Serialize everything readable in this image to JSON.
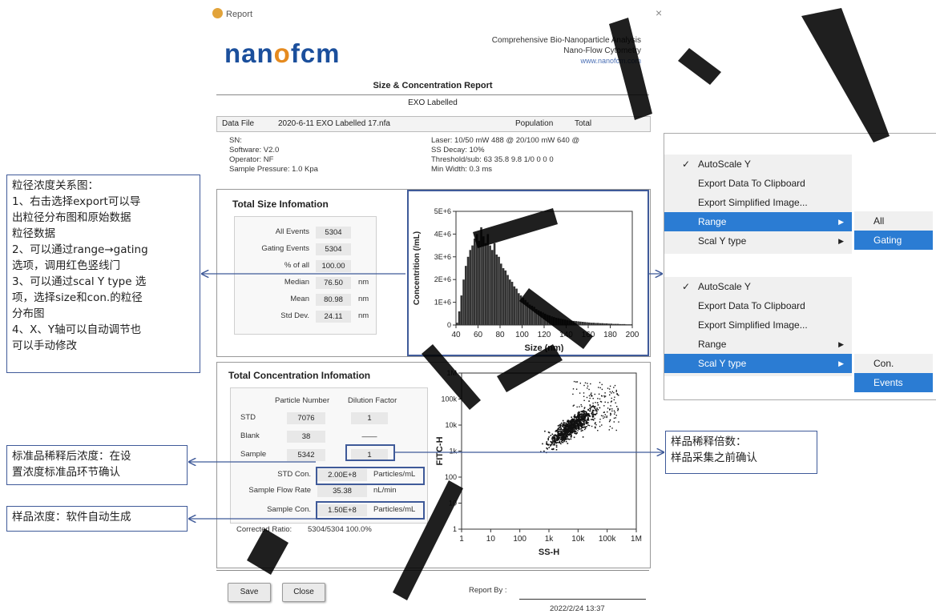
{
  "window": {
    "title": "Report",
    "close": "×"
  },
  "header": {
    "logo_a": "nan",
    "logo_o": "o",
    "logo_b": "fcm",
    "company_line1": "Comprehensive Bio-Nanoparticle Analysis",
    "company_line2": "Nano-Flow Cytometry",
    "company_url": "www.nanofcm.com"
  },
  "report": {
    "title": "Size & Concentration Report",
    "subtitle": "EXO Labelled",
    "data_file_label": "Data File",
    "data_file": "2020-6-11 EXO Labelled 17.nfa",
    "population_label": "Population",
    "population": "Total",
    "meta_left": [
      "SN:",
      "Software: V2.0",
      "Operator: NF",
      "Sample Pressure: 1.0 Kpa"
    ],
    "meta_right": [
      "Laser: 10/50 mW 488 @ 20/100 mW 640 @",
      "SS Decay: 10%",
      "Threshold/sub: 63 35.8 9.8 1/0 0 0 0",
      "Min Width: 0.3 ms"
    ]
  },
  "size_info": {
    "title": "Total Size Infomation",
    "rows": [
      {
        "label": "All Events",
        "value": "5304",
        "unit": ""
      },
      {
        "label": "Gating Events",
        "value": "5304",
        "unit": ""
      },
      {
        "label": "% of all",
        "value": "100.00",
        "unit": ""
      },
      {
        "label": "Median",
        "value": "76.50",
        "unit": "nm"
      },
      {
        "label": "Mean",
        "value": "80.98",
        "unit": "nm"
      },
      {
        "label": "Std Dev.",
        "value": "24.11",
        "unit": "nm"
      }
    ]
  },
  "conc_info": {
    "title": "Total Concentration Infomation",
    "col_particle": "Particle Number",
    "col_dilution": "Dilution Factor",
    "rows": [
      {
        "label": "STD",
        "particle": "7076",
        "dilution": "1"
      },
      {
        "label": "Blank",
        "particle": "38",
        "dilution": "——"
      },
      {
        "label": "Sample",
        "particle": "5342",
        "dilution": "1"
      }
    ],
    "std_con_label": "STD Con.",
    "std_con": "2.00E+8",
    "std_con_unit": "Particles/mL",
    "flow_label": "Sample Flow Rate",
    "flow": "35.38",
    "flow_unit": "nL/min",
    "sample_con_label": "Sample Con.",
    "sample_con": "1.50E+8",
    "sample_con_unit": "Particles/mL",
    "corrected_label": "Corrected Ratio:",
    "corrected": "5304/5304  100.0%"
  },
  "chart_data": [
    {
      "type": "bar",
      "xlabel": "Size (nm)",
      "ylabel": "Concentrition (/mL)",
      "xlim": [
        40,
        200
      ],
      "ylim": [
        0,
        5000000
      ],
      "xticks": [
        "40",
        "60",
        "80",
        "100",
        "120",
        "140",
        "160",
        "180",
        "200"
      ],
      "yticks": [
        "0",
        "1E+6",
        "2E+6",
        "3E+6",
        "4E+6",
        "5E+6"
      ],
      "x": [
        41,
        43,
        45,
        47,
        49,
        51,
        53,
        55,
        57,
        59,
        61,
        63,
        65,
        67,
        69,
        71,
        73,
        75,
        77,
        79,
        81,
        83,
        85,
        87,
        89,
        91,
        93,
        95,
        97,
        99,
        101,
        103,
        105,
        107,
        109,
        111,
        113,
        115,
        117,
        119,
        121,
        123,
        125,
        127,
        129,
        131,
        133,
        135,
        137,
        139,
        141,
        143,
        145,
        147,
        149,
        151,
        153,
        155,
        157,
        159,
        161,
        163,
        165,
        167,
        169,
        171,
        173,
        175,
        177,
        179,
        181,
        183,
        185,
        187,
        189,
        191,
        193,
        195,
        197,
        199
      ],
      "values": [
        100000,
        600000,
        1300000,
        2000000,
        2600000,
        3000000,
        3300000,
        3500000,
        3800000,
        4000000,
        3700000,
        4300000,
        3900000,
        3600000,
        4000000,
        3500000,
        3300000,
        3600000,
        3100000,
        3000000,
        2700000,
        2500000,
        2400000,
        2200000,
        2000000,
        1900000,
        1700000,
        1600000,
        1400000,
        1300000,
        1200000,
        1100000,
        1000000,
        900000,
        850000,
        800000,
        700000,
        650000,
        600000,
        550000,
        500000,
        450000,
        420000,
        380000,
        350000,
        320000,
        300000,
        280000,
        260000,
        240000,
        220000,
        200000,
        190000,
        180000,
        170000,
        160000,
        150000,
        140000,
        130000,
        120000,
        110000,
        100000,
        100000,
        90000,
        90000,
        80000,
        80000,
        70000,
        70000,
        60000,
        60000,
        50000,
        50000,
        50000,
        40000,
        40000,
        40000,
        30000,
        30000,
        30000
      ]
    },
    {
      "type": "scatter",
      "xlabel": "SS-H",
      "ylabel": "FITC-H",
      "xticks": [
        "1",
        "10",
        "100",
        "1k",
        "10k",
        "100k",
        "1M"
      ],
      "yticks": [
        "1",
        "10",
        "100",
        "1k",
        "10k",
        "100k",
        "1M"
      ],
      "xscale": "log",
      "yscale": "log"
    }
  ],
  "context_menu": {
    "top": {
      "items": [
        {
          "label": "AutoScale Y",
          "checked": "✓"
        },
        {
          "label": "Export Data To Clipboard"
        },
        {
          "label": "Export Simplified Image..."
        },
        {
          "label": "Range"
        },
        {
          "label": "Scal Y type"
        }
      ],
      "submenu": [
        "All",
        "Gating"
      ]
    },
    "bottom": {
      "items": [
        {
          "label": "AutoScale Y",
          "checked": "✓"
        },
        {
          "label": "Export Data To Clipboard"
        },
        {
          "label": "Export Simplified Image..."
        },
        {
          "label": "Range"
        },
        {
          "label": "Scal Y type"
        }
      ],
      "submenu": [
        "Con.",
        "Events"
      ]
    },
    "arrow": "▶"
  },
  "notes": {
    "left_main": [
      "粒径浓度关系图：",
      "1、右击选择export可以导",
      "出粒径分布图和原始数据",
      "粒径数据",
      "2、可以通过range→gating",
      "选项，调用红色竖线门",
      "3、可以通过scal Y type 选",
      "项，选择size和con.的粒径",
      "分布图",
      "4、X、Y轴可以自动调节也",
      "可以手动修改"
    ],
    "std_note": [
      "标准品稀释后浓度：在设",
      "置浓度标准品环节确认"
    ],
    "sample_note": "样品浓度：软件自动生成",
    "dilution_note": [
      "样品稀释倍数：",
      "样品采集之前确认"
    ]
  },
  "footer": {
    "save": "Save",
    "close": "Close",
    "report_by": "Report By :",
    "datetime": "2022/2/24 13:37"
  }
}
